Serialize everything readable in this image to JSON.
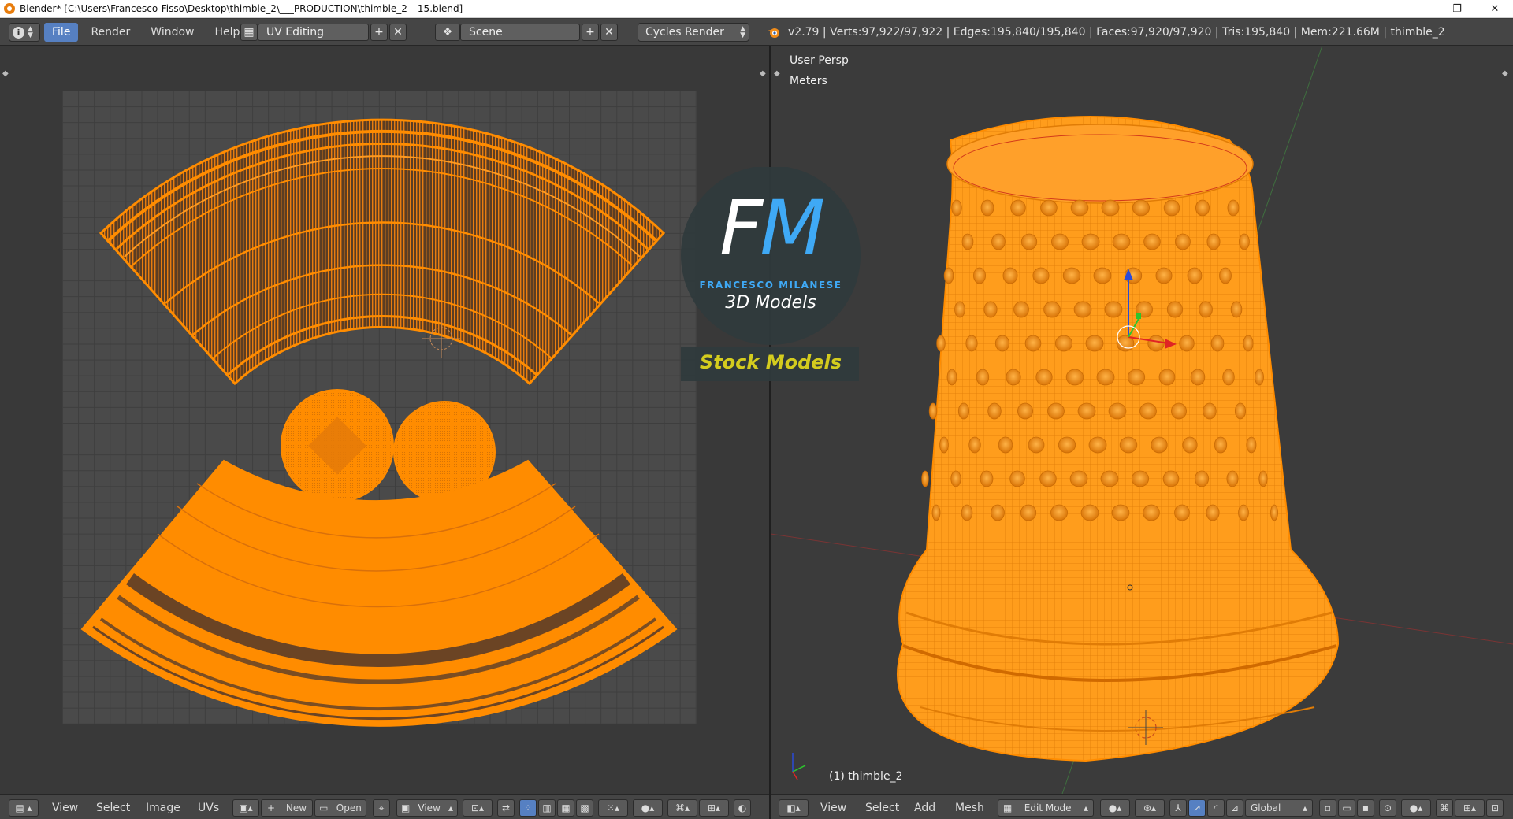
{
  "window": {
    "title": "Blender* [C:\\Users\\Francesco-Fisso\\Desktop\\thimble_2\\___PRODUCTION\\thimble_2---15.blend]",
    "minimize": "—",
    "restore": "❐",
    "close": "✕"
  },
  "header": {
    "menus": [
      "File",
      "Render",
      "Window",
      "Help"
    ],
    "screen_layout": "UV Editing",
    "scene": "Scene",
    "render_engine": "Cycles Render",
    "stats": "v2.79 | Verts:97,922/97,922 | Edges:195,840/195,840 | Faces:97,920/97,920 | Tris:195,840 | Mem:221.66M | thimble_2"
  },
  "viewport": {
    "view_name": "User Persp",
    "units": "Meters",
    "object_label": "(1) thimble_2"
  },
  "watermark": {
    "initials_f": "F",
    "initials_m": "M",
    "brand": "FRANCESCO MILANESE",
    "tagline": "3D Models",
    "badge": "Stock Models"
  },
  "uv_footer": {
    "menus": [
      "View",
      "Select",
      "Image",
      "UVs"
    ],
    "new_label": "New",
    "open_label": "Open",
    "view_label": "View"
  },
  "viewport_footer": {
    "menus": [
      "View",
      "Select",
      "Add",
      "Mesh"
    ],
    "mode": "Edit Mode",
    "orientation": "Global"
  },
  "colors": {
    "accent": "#5680c2",
    "mesh_orange": "#ff8c00",
    "wire_orange": "#ffa033",
    "logo_blue": "#3fa9f5",
    "badge_yellow": "#d4cc1e"
  }
}
